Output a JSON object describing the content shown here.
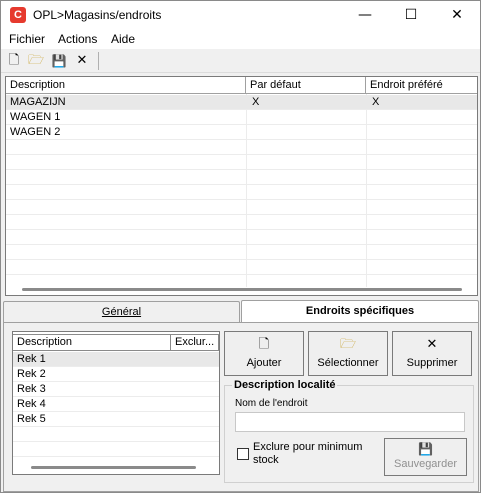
{
  "app": {
    "icon_letter": "C",
    "title": "OPL>Magasins/endroits"
  },
  "window_controls": {
    "minimize": "—",
    "maximize": "☐",
    "close": "✕"
  },
  "menu": [
    "Fichier",
    "Actions",
    "Aide"
  ],
  "toolbar": {
    "icons": [
      "new-file-icon",
      "open-folder-icon",
      "save-disk-icon",
      "delete-x-icon"
    ],
    "glyphs": [
      "🗋",
      "🗁",
      "💾",
      "✕"
    ]
  },
  "main_grid": {
    "columns": [
      "Description",
      "Par défaut",
      "Endroit préféré"
    ],
    "rows": [
      {
        "description": "MAGAZIJN",
        "default": "X",
        "preferred": "X"
      },
      {
        "description": "WAGEN 1",
        "default": "",
        "preferred": ""
      },
      {
        "description": "WAGEN 2",
        "default": "",
        "preferred": ""
      }
    ]
  },
  "tabs": {
    "general": "Général",
    "specific": "Endroits spécifiques",
    "active": "specific"
  },
  "sub_grid": {
    "columns": [
      "Description",
      "Exclur..."
    ],
    "rows": [
      "Rek 1",
      "Rek 2",
      "Rek 3",
      "Rek 4",
      "Rek 5"
    ]
  },
  "buttons": {
    "add": {
      "label": "Ajouter",
      "icon": "🗋"
    },
    "select": {
      "label": "Sélectionner",
      "icon": "🗁"
    },
    "delete": {
      "label": "Supprimer",
      "icon": "✕"
    },
    "save": {
      "label": "Sauvegarder",
      "icon": "💾",
      "disabled": true
    }
  },
  "location": {
    "group_title": "Description localité",
    "name_label": "Nom de l'endroit",
    "name_value": "",
    "exclude_label": "Exclure pour minimum stock",
    "exclude_checked": false
  }
}
